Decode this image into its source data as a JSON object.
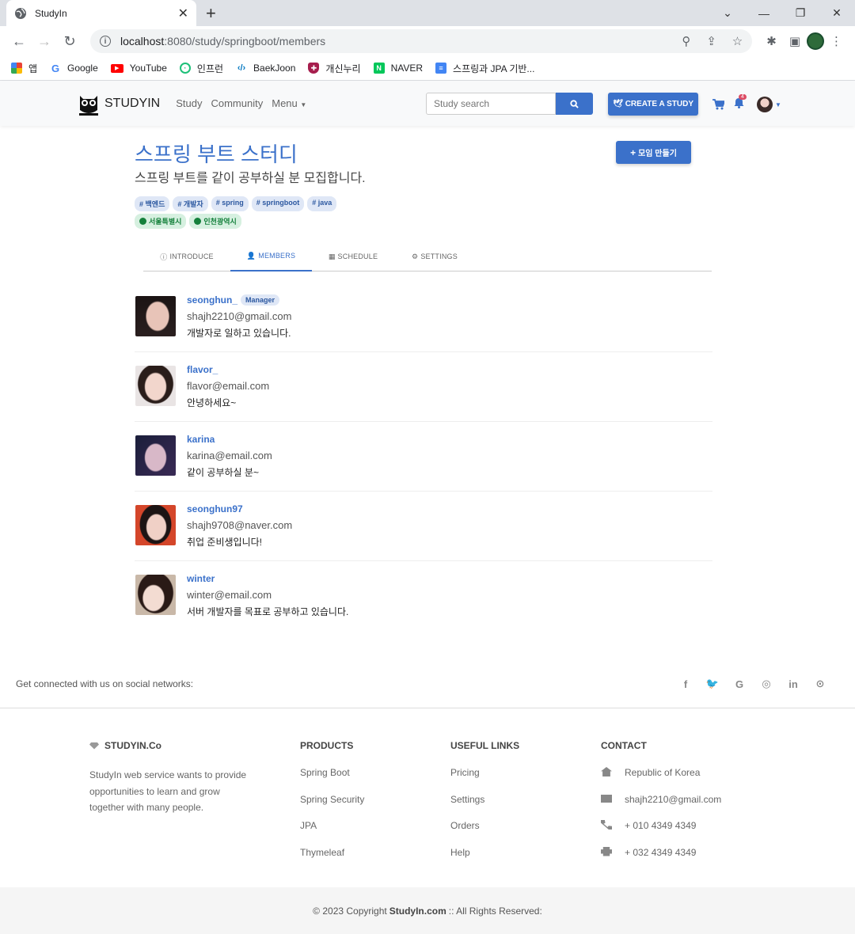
{
  "browser": {
    "tab_title": "StudyIn",
    "url_host": "localhost",
    "url_path": ":8080/study/springboot/members",
    "bookmarks": [
      {
        "label": "앱",
        "icon": "apps-grid-icon"
      },
      {
        "label": "Google",
        "icon": "google-icon"
      },
      {
        "label": "YouTube",
        "icon": "youtube-icon"
      },
      {
        "label": "인프런",
        "icon": "inflearn-icon"
      },
      {
        "label": "BaekJoon",
        "icon": "code-icon"
      },
      {
        "label": "개신누리",
        "icon": "university-icon"
      },
      {
        "label": "NAVER",
        "icon": "naver-icon"
      },
      {
        "label": "스프링과 JPA 기반...",
        "icon": "doc-icon"
      }
    ]
  },
  "nav": {
    "brand": "STUDYIN",
    "links": [
      "Study",
      "Community",
      "Menu"
    ],
    "search_placeholder": "Study search",
    "create_label": "CREATE A STUDY",
    "notification_count": "4"
  },
  "study": {
    "title": "스프링 부트 스터디",
    "description": "스프링 부트를 같이 공부하실 분 모집합니다.",
    "make_button": "모임 만들기",
    "tags": [
      "백엔드",
      "개발자",
      "spring",
      "springboot",
      "java"
    ],
    "zones": [
      "서울특별시",
      "인천광역시"
    ],
    "tabs": [
      "INTRODUCE",
      "MEMBERS",
      "SCHEDULE",
      "SETTINGS"
    ],
    "active_tab": "MEMBERS"
  },
  "members": [
    {
      "name": "seonghun_",
      "role": "Manager",
      "email": "shajh2210@gmail.com",
      "bio": "개발자로 일하고 있습니다."
    },
    {
      "name": "flavor_",
      "role": "",
      "email": "flavor@email.com",
      "bio": "안녕하세요~"
    },
    {
      "name": "karina",
      "role": "",
      "email": "karina@email.com",
      "bio": "같이 공부하실 분~"
    },
    {
      "name": "seonghun97",
      "role": "",
      "email": "shajh9708@naver.com",
      "bio": "취업 준비생입니다!"
    },
    {
      "name": "winter",
      "role": "",
      "email": "winter@email.com",
      "bio": "서버 개발자를 목표로 공부하고 있습니다."
    }
  ],
  "footer": {
    "social_text": "Get connected with us on social networks:",
    "brand": "STUDYIN.Co",
    "brand_desc": "StudyIn web service wants to provide opportunities to learn and grow together with many people.",
    "products_head": "PRODUCTS",
    "products": [
      "Spring Boot",
      "Spring Security",
      "JPA",
      "Thymeleaf"
    ],
    "links_head": "USEFUL LINKS",
    "links": [
      "Pricing",
      "Settings",
      "Orders",
      "Help"
    ],
    "contact_head": "CONTACT",
    "contact": [
      "Republic of Korea",
      "shajh2210@gmail.com",
      "+ 010 4349 4349",
      "+ 032 4349 4349"
    ],
    "copyright_prefix": "© 2023 Copyright",
    "copyright_brand": "StudyIn.com",
    "copyright_suffix": ":: All Rights Reserved:"
  },
  "colors": {
    "primary": "#3b71ca",
    "tag_bg": "#dfe7f6",
    "zone_bg": "#d6f0e0",
    "zone_text": "#14803b",
    "badge": "#dc4c64"
  }
}
